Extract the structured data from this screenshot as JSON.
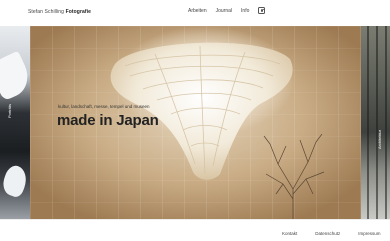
{
  "header": {
    "brand_name": "Stefan Schilling",
    "brand_suffix": "Fotografie",
    "nav": [
      {
        "label": "Arbeiten"
      },
      {
        "label": "Journal"
      },
      {
        "label": "Info"
      }
    ],
    "instagram_icon": "instagram-icon"
  },
  "slider": {
    "left_label": "Porträts",
    "current": {
      "subtitle": "kultur, landschaft, messe, tempel und museen",
      "title": "made in Japan"
    },
    "right_label": "Architektur"
  },
  "footer": {
    "links": [
      {
        "label": "Kontakt"
      },
      {
        "label": "Datenschutz"
      },
      {
        "label": "Impressum"
      }
    ]
  }
}
